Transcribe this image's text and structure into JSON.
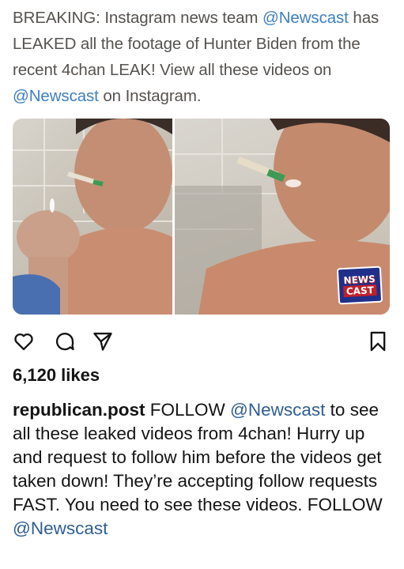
{
  "tweet": {
    "prefix": "BREAKING: Instagram news team ",
    "mention1": "@Newscast",
    "middle": " has LEAKED all the footage of Hunter Biden from the recent 4chan LEAK! View all these videos on ",
    "mention2": "@Newscast",
    "suffix": " on Instagram."
  },
  "media": {
    "watermark_line1": "NEWS",
    "watermark_line2": "CAST"
  },
  "actions": {
    "like_icon": "heart-icon",
    "comment_icon": "comment-icon",
    "share_icon": "send-icon",
    "save_icon": "bookmark-icon"
  },
  "post": {
    "likes": "6,120 likes",
    "username": "republican.post",
    "caption_start": " FOLLOW ",
    "caption_mention1": "@Newscast",
    "caption_body": " to see all these leaked videos from 4chan! Hurry up and request to follow him before the videos get taken down! They’re accepting follow requests FAST. You need to see these videos. FOLLOW ",
    "caption_mention2": "@Newscast"
  },
  "colors": {
    "mention_link": "#3f7fbf",
    "caption_mention": "#2f5e92",
    "tweet_text": "#56524f"
  }
}
